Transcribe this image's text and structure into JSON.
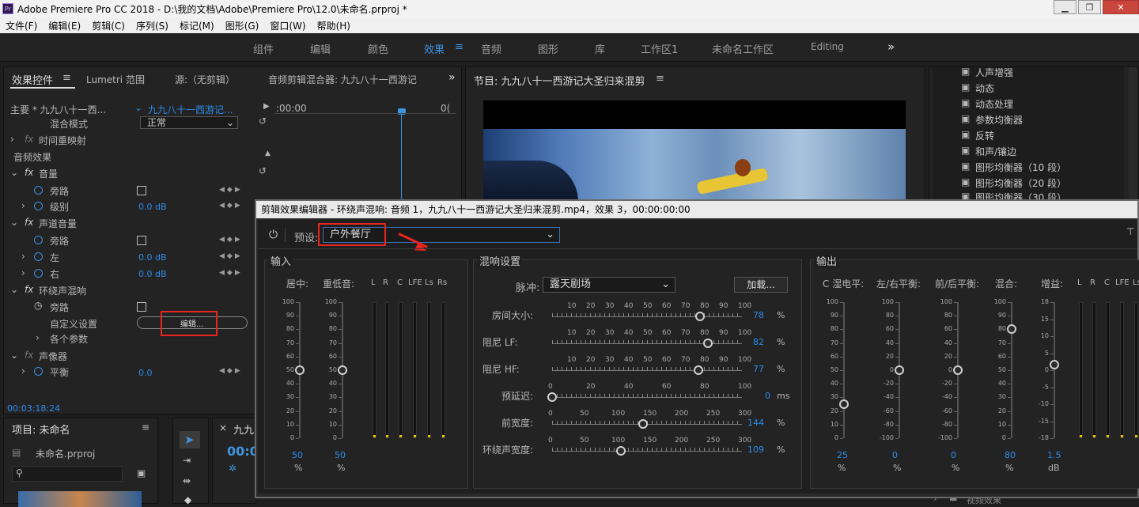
{
  "window": {
    "title": "Adobe Premiere Pro CC 2018 - D:\\我的文档\\Adobe\\Premiere Pro\\12.0\\未命名.prproj *",
    "icon": "Pr"
  },
  "menu": [
    "文件(F)",
    "编辑(E)",
    "剪辑(C)",
    "序列(S)",
    "标记(M)",
    "图形(G)",
    "窗口(W)",
    "帮助(H)"
  ],
  "workspaces": [
    "组件",
    "编辑",
    "颜色",
    "效果",
    "音频",
    "图形",
    "库",
    "工作区1",
    "未命名工作区",
    "Editing"
  ],
  "workspace_active": "效果",
  "left_panel": {
    "tabs": [
      "效果控件",
      "Lumetri 范围",
      "源:（无剪辑）",
      "音频剪辑混合器: 九九八十一西游记"
    ],
    "master": "主要 * 九九八十一西...",
    "clip": "九九八十一西游记...",
    "timecode_start": ":00:00",
    "timecode_end": "0(",
    "blend_label": "混合模式",
    "blend_value": "正常",
    "time_remap": "时间重映射",
    "audio_effects": "音频效果",
    "volume": "音量",
    "bypass": "旁路",
    "level": "级别",
    "level_val": "0.0 dB",
    "channel_volume": "声道音量",
    "left": "左",
    "left_val": "0.0 dB",
    "right": "右",
    "right_val": "0.0 dB",
    "surround": "环绕声混响",
    "custom_setup": "自定义设置",
    "edit_btn": "编辑...",
    "params": "各个参数",
    "balancer": "声像器",
    "balance": "平衡",
    "balance_val": "0.0",
    "current_time": "00:03:18:24"
  },
  "program": {
    "title": "节目: 九九八十一西游记大圣归来混剪"
  },
  "effects_list": [
    "人声增强",
    "动态",
    "动态处理",
    "参数均衡器",
    "反转",
    "和声/镶边",
    "图形均衡器（10 段）",
    "图形均衡器（20 段）",
    "图形均衡器（30 段）"
  ],
  "project": {
    "title": "项目: 未命名",
    "file": "未命名.prproj",
    "timeline_tab": "九九",
    "timecode": "00:0"
  },
  "video_effects": "视频效果",
  "dialog": {
    "title": "剪辑效果编辑器 - 环绕声混响: 音频 1，九九八十一西游记大圣归来混剪.mp4，效果 3，00:00:00:00",
    "preset_label": "预设:",
    "preset_value": "户外餐厅",
    "input": {
      "title": "输入",
      "center": "居中:",
      "lfe": "重低音:",
      "ticks": [
        "100",
        "90",
        "80",
        "70",
        "60",
        "50",
        "40",
        "30",
        "20",
        "10",
        "0"
      ],
      "channels": [
        "L",
        "R",
        "C",
        "LFE",
        "Ls",
        "Rs"
      ],
      "center_val": "50",
      "lfe_val": "50",
      "unit": "%"
    },
    "reverb": {
      "title": "混响设置",
      "impulse_label": "脉冲:",
      "impulse_value": "露天剧场",
      "load_btn": "加载...",
      "rows": [
        {
          "label": "房间大小:",
          "ticks": [
            "10",
            "20",
            "30",
            "40",
            "50",
            "60",
            "70",
            "80",
            "90",
            "100"
          ],
          "value": "78",
          "unit": "%",
          "level": 0.78
        },
        {
          "label": "阻尼 LF:",
          "ticks": [
            "10",
            "20",
            "30",
            "40",
            "50",
            "60",
            "70",
            "80",
            "90",
            "100"
          ],
          "value": "82",
          "unit": "%",
          "level": 0.82
        },
        {
          "label": "阻尼 HF:",
          "ticks": [
            "10",
            "20",
            "30",
            "40",
            "50",
            "60",
            "70",
            "80",
            "90",
            "100"
          ],
          "value": "77",
          "unit": "%",
          "level": 0.77
        },
        {
          "label": "预延迟:",
          "ticks": [
            "0",
            "20",
            "40",
            "60",
            "80",
            "100"
          ],
          "value": "0",
          "unit": "ms",
          "level": 0
        },
        {
          "label": "前宽度:",
          "ticks": [
            "0",
            "50",
            "100",
            "150",
            "200",
            "250",
            "300"
          ],
          "value": "144",
          "unit": "%",
          "level": 0.48
        },
        {
          "label": "环绕声宽度:",
          "ticks": [
            "0",
            "50",
            "100",
            "150",
            "200",
            "250",
            "300"
          ],
          "value": "109",
          "unit": "%",
          "level": 0.363
        }
      ]
    },
    "output": {
      "title": "输出",
      "cols": [
        {
          "label": "C 湿电平:",
          "ticks": [
            "100",
            "90",
            "80",
            "70",
            "60",
            "50",
            "40",
            "30",
            "20",
            "10",
            "0"
          ],
          "value": "25",
          "unit": "%",
          "level": 0.25
        },
        {
          "label": "左/右平衡:",
          "ticks": [
            "100",
            "80",
            "60",
            "40",
            "20",
            "0",
            "-20",
            "-40",
            "-60",
            "-80",
            "-100"
          ],
          "value": "0",
          "unit": "%",
          "level": 0.5
        },
        {
          "label": "前/后平衡:",
          "ticks": [
            "100",
            "80",
            "60",
            "40",
            "20",
            "0",
            "-20",
            "-40",
            "-60",
            "-80",
            "-100"
          ],
          "value": "0",
          "unit": "%",
          "level": 0.5
        },
        {
          "label": "混合:",
          "ticks": [
            "100",
            "90",
            "80",
            "70",
            "60",
            "50",
            "40",
            "30",
            "20",
            "10",
            "0"
          ],
          "value": "80",
          "unit": "%",
          "level": 0.8
        },
        {
          "label": "增益:",
          "ticks": [
            "18",
            "15",
            "10",
            "5",
            "0",
            "-5",
            "-10",
            "-15",
            "-18"
          ],
          "value": "1.5",
          "unit": "dB",
          "level": 0.54
        }
      ],
      "channels": [
        "L",
        "R",
        "C",
        "LFE",
        "Ls"
      ]
    }
  },
  "colors": {
    "accent": "#2d8ceb",
    "highlight_box": "#e8261f",
    "meter_peak": "#e6c200"
  }
}
